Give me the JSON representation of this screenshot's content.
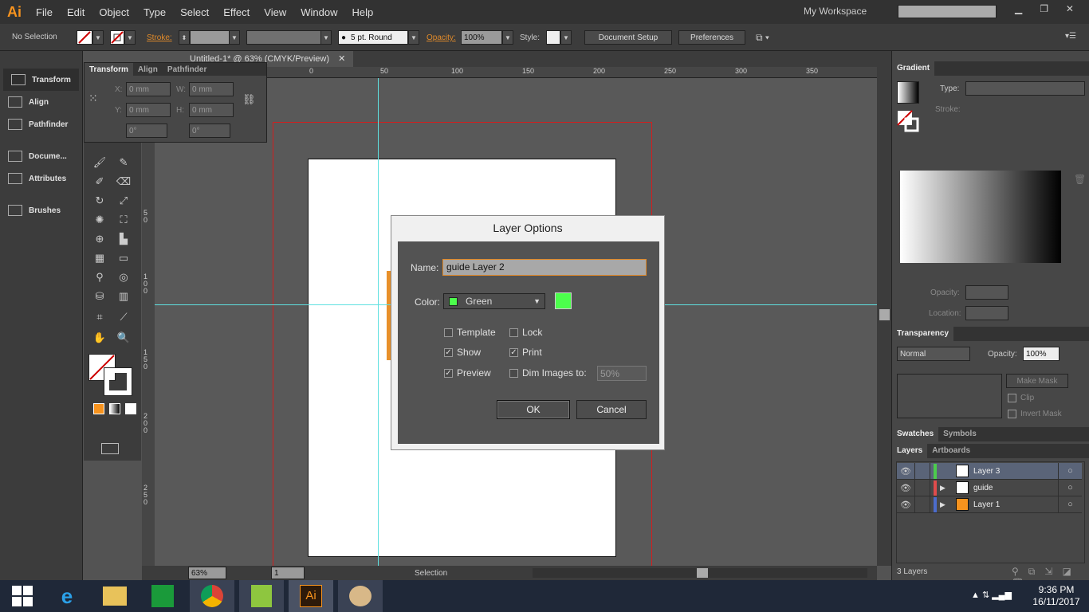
{
  "app": {
    "logo": "Ai",
    "workspace": "My Workspace",
    "search_placeholder": ""
  },
  "menu": [
    "File",
    "Edit",
    "Object",
    "Type",
    "Select",
    "Effect",
    "View",
    "Window",
    "Help"
  ],
  "control": {
    "selection": "No Selection",
    "stroke_label": "Stroke:",
    "brush": "5 pt. Round",
    "opacity_label": "Opacity:",
    "opacity": "100%",
    "style_label": "Style:",
    "document_setup": "Document Setup",
    "preferences": "Preferences"
  },
  "left_dock": [
    "Transform",
    "Align",
    "Pathfinder",
    "Docume...",
    "Attributes",
    "Brushes"
  ],
  "transform_panel": {
    "tabs": [
      "Transform",
      "Align",
      "Pathfinder"
    ],
    "x_label": "X:",
    "y_label": "Y:",
    "w_label": "W:",
    "h_label": "H:",
    "x": "0 mm",
    "y": "0 mm",
    "w": "0 mm",
    "h": "0 mm",
    "angle": "0°",
    "shear": "0°"
  },
  "document": {
    "tab_title": "Untitled-1* @ 63% (CMYK/Preview)",
    "ruler_h": [
      "0",
      "50",
      "100",
      "150",
      "200",
      "250",
      "300",
      "350"
    ],
    "ruler_v": [
      "5 0",
      "1 0 0",
      "1 5 0",
      "2 0 0",
      "2 5 0"
    ],
    "zoom": "63%",
    "artboard": "1",
    "status": "Selection"
  },
  "dialog": {
    "title": "Layer Options",
    "name_label": "Name:",
    "name_value": "guide Layer 2",
    "color_label": "Color:",
    "color_value": "Green",
    "color_hex": "#4cff4c",
    "template": "Template",
    "lock": "Lock",
    "show": "Show",
    "print": "Print",
    "preview": "Preview",
    "dim": "Dim Images to:",
    "dim_value": "50%",
    "ok": "OK",
    "cancel": "Cancel",
    "checked": {
      "template": false,
      "lock": false,
      "show": true,
      "print": true,
      "preview": true,
      "dim": false
    }
  },
  "gradient": {
    "title": "Gradient",
    "type_label": "Type:",
    "stroke_label": "Stroke:",
    "opacity_label": "Opacity:",
    "location_label": "Location:"
  },
  "transparency": {
    "title": "Transparency",
    "mode": "Normal",
    "opacity_label": "Opacity:",
    "opacity": "100%",
    "make_mask": "Make Mask",
    "clip": "Clip",
    "invert": "Invert Mask"
  },
  "swatches_tabs": [
    "Swatches",
    "Symbols"
  ],
  "layers": {
    "tabs": [
      "Layers",
      "Artboards"
    ],
    "count": "3 Layers",
    "items": [
      {
        "name": "Layer 3",
        "color": "#4ccc4c",
        "thumb": "#ffffff",
        "selected": true,
        "expand": false
      },
      {
        "name": "guide",
        "color": "#e04c4c",
        "thumb": "#ffffff",
        "selected": false,
        "expand": true
      },
      {
        "name": "Layer 1",
        "color": "#4c6ccc",
        "thumb": "#f7931e",
        "selected": false,
        "expand": true
      }
    ]
  },
  "taskbar": {
    "time": "9:36 PM",
    "date": "16/11/2017"
  }
}
